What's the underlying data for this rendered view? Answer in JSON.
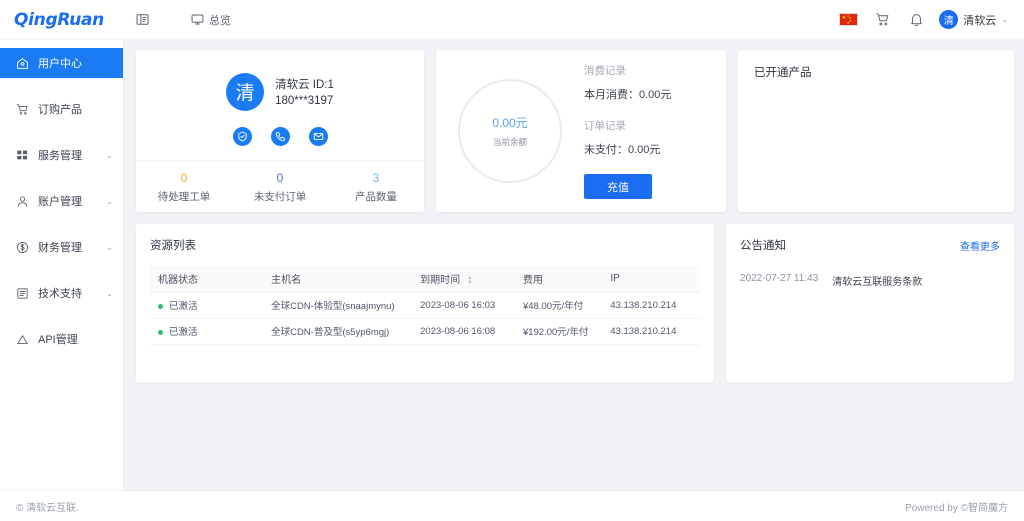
{
  "brand": {
    "logo_text": "QingRuan",
    "accent": "#1a6cf0"
  },
  "header": {
    "collapse_icon": "menu-collapse-icon",
    "overview_label": "总览",
    "overview_icon": "monitor-icon",
    "flag_icon": "china-flag-icon",
    "cart_icon": "shopping-cart-icon",
    "bell_icon": "bell-icon",
    "user": {
      "avatar_text": "清",
      "name": "清软云",
      "caret": "⌄"
    }
  },
  "sidebar": {
    "items": [
      {
        "label": "用户中心",
        "icon": "home-icon",
        "active": true,
        "expandable": false
      },
      {
        "label": "订购产品",
        "icon": "cart-icon",
        "active": false,
        "expandable": false
      },
      {
        "label": "服务管理",
        "icon": "grid-icon",
        "active": false,
        "expandable": true
      },
      {
        "label": "账户管理",
        "icon": "user-icon",
        "active": false,
        "expandable": true
      },
      {
        "label": "财务管理",
        "icon": "dollar-circle-icon",
        "active": false,
        "expandable": true
      },
      {
        "label": "技术支持",
        "icon": "document-icon",
        "active": false,
        "expandable": true
      },
      {
        "label": "API管理",
        "icon": "triangle-icon",
        "active": false,
        "expandable": false
      }
    ],
    "caret": "⌄"
  },
  "user_card": {
    "avatar_text": "清",
    "name_id": "清软云 ID:1",
    "phone": "180***3197",
    "action_icons": [
      {
        "name": "verify-shield-icon",
        "glyph": "shield"
      },
      {
        "name": "phone-icon",
        "glyph": "phone"
      },
      {
        "name": "email-icon",
        "glyph": "mail"
      }
    ],
    "stats": [
      {
        "value": "0",
        "label": "待处理工单",
        "color": "#f5a623"
      },
      {
        "value": "0",
        "label": "未支付订单",
        "color": "#5470c6"
      },
      {
        "value": "3",
        "label": "产品数量",
        "color": "#6fb1f0"
      }
    ]
  },
  "balance_card": {
    "amount": "0.00元",
    "amount_label": "当前余额",
    "consume_title": "消费记录",
    "consume_value": "本月消费：0.00元",
    "order_title": "订单记录",
    "order_value": "未支付：0.00元",
    "topup_button": "充值"
  },
  "products_card": {
    "title": "已开通产品"
  },
  "resource_card": {
    "title": "资源列表",
    "columns": [
      "机器状态",
      "主机名",
      "到期时间",
      "费用",
      "IP"
    ],
    "rows": [
      {
        "status": "已激活",
        "hostname": "全球CDN-体验型(snaajmynu)",
        "expire": "2023-08-06 16:03",
        "fee": "¥48.00元/年付",
        "ip": "43.138.210.214"
      },
      {
        "status": "已激活",
        "hostname": "全球CDN-普及型(s5yp6mgj)",
        "expire": "2023-08-06 16:08",
        "fee": "¥192.00元/年付",
        "ip": "43.138.210.214"
      }
    ]
  },
  "notice_card": {
    "title": "公告通知",
    "more_label": "查看更多",
    "items": [
      {
        "date": "2022-07-27 11:43",
        "text": "清软云互联服务条款"
      }
    ]
  },
  "footer": {
    "left": "© 清软云互联.",
    "right": "Powered by ©智简魔方"
  }
}
